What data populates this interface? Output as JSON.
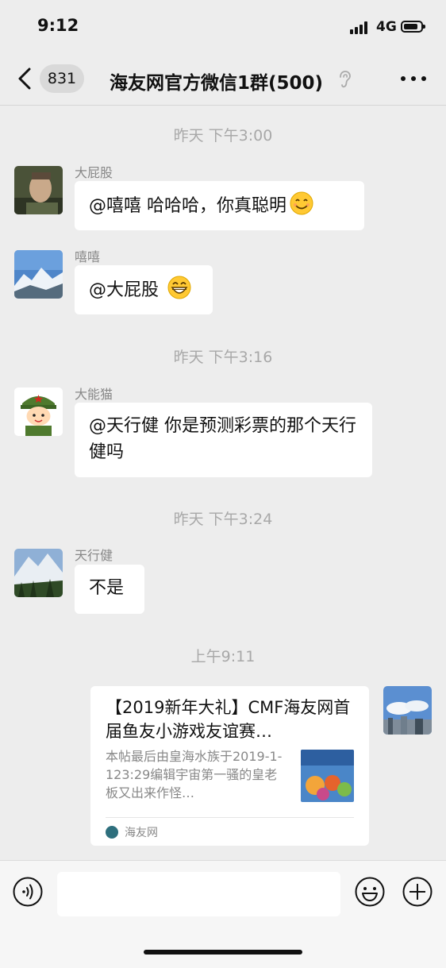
{
  "status_bar": {
    "time": "9:12",
    "network": "4G"
  },
  "nav": {
    "unread_count": "831",
    "title": "海友网官方微信1群(500)"
  },
  "messages": [
    {
      "timestamp": "昨天 下午3:00",
      "sender": "大屁股",
      "text": "@嘻嘻 哈哈哈，你真聪明",
      "emoji": "smile-emoji"
    },
    {
      "sender": "嘻嘻",
      "text": "@大屁股 ",
      "emoji": "grin-emoji"
    },
    {
      "timestamp": "昨天 下午3:16",
      "sender": "大能猫",
      "text": "@天行健 你是预测彩票的那个天行健吗"
    },
    {
      "timestamp": "昨天 下午3:24",
      "sender": "天行健",
      "text": "不是"
    },
    {
      "timestamp": "上午9:11",
      "link_card": {
        "title": "【2019新年大礼】CMF海友网首届鱼友小游戏友谊赛…",
        "description": "本帖最后由皇海水族于2019-1-123:29编辑宇宙第一骚的皇老板又出来作怪…",
        "source": "海友网"
      }
    }
  ],
  "input_bar": {
    "voice_icon": "voice-icon",
    "emoji_icon": "emoji-icon",
    "add_icon": "add-icon"
  }
}
